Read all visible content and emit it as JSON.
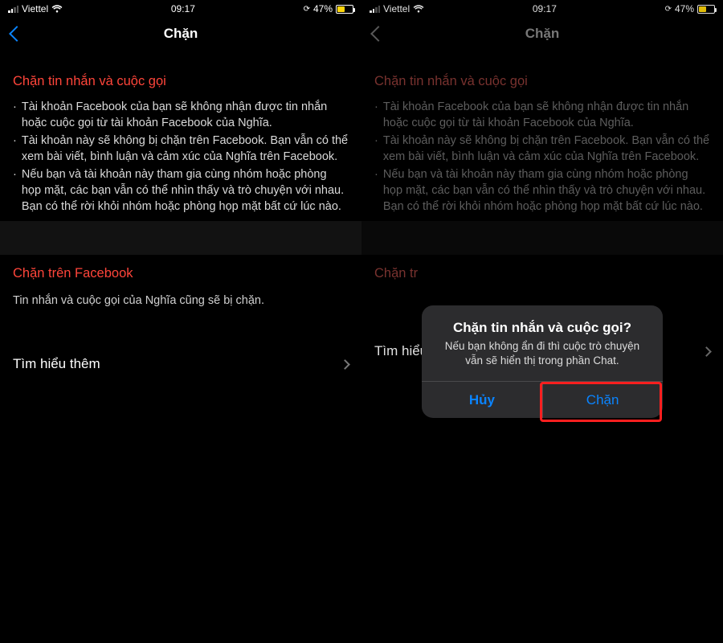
{
  "status": {
    "carrier": "Viettel",
    "time": "09:17",
    "battery_pct": "47%",
    "battery_fill_width": "47%",
    "battery_fill_color": "#ffd60a"
  },
  "left": {
    "nav_title": "Chặn",
    "section1_title": "Chặn tin nhắn và cuộc gọi",
    "bullet1": "Tài khoản Facebook của bạn sẽ không nhận được tin nhắn hoặc cuộc gọi từ tài khoản Facebook của Nghĩa.",
    "bullet2": "Tài khoản này sẽ không bị chặn trên Facebook. Bạn vẫn có thể xem bài viết, bình luận và cảm xúc của Nghĩa trên Facebook.",
    "bullet3": "Nếu bạn và tài khoản này tham gia cùng nhóm hoặc phòng họp mặt, các bạn vẫn có thể nhìn thấy và trò chuyện với nhau. Bạn có thể rời khỏi nhóm hoặc phòng họp mặt bất cứ lúc nào.",
    "section2_title": "Chặn trên Facebook",
    "section2_body": "Tin nhắn và cuộc gọi của Nghĩa cũng sẽ bị chặn.",
    "learn_more": "Tìm hiểu thêm"
  },
  "right": {
    "nav_title": "Chặn",
    "section1_title": "Chặn tin nhắn và cuộc gọi",
    "bullet1": "Tài khoản Facebook của bạn sẽ không nhận được tin nhắn hoặc cuộc gọi từ tài khoản Facebook của Nghĩa.",
    "bullet2": "Tài khoản này sẽ không bị chặn trên Facebook. Bạn vẫn có thể xem bài viết, bình luận và cảm xúc của Nghĩa trên Facebook.",
    "bullet3": "Nếu bạn và tài khoản này tham gia cùng nhóm hoặc phòng họp mặt, các bạn vẫn có thể nhìn thấy và trò chuyện với nhau. Bạn có thể rời khỏi nhóm hoặc phòng họp mặt bất cứ lúc nào.",
    "section2_title_partial": "Chặn tr",
    "learn_more": "Tìm hiểu thêm",
    "alert_title": "Chặn tin nhắn và cuộc gọi?",
    "alert_message": "Nếu bạn không ẩn đi thì cuộc trò chuyện vẫn sẽ hiển thị trong phần Chat.",
    "alert_cancel": "Hủy",
    "alert_confirm": "Chặn"
  }
}
